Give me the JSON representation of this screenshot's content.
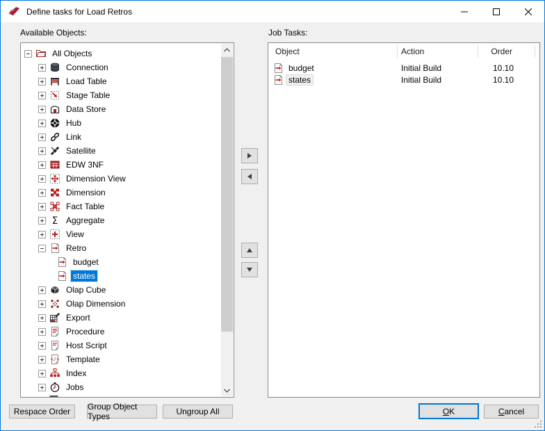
{
  "window": {
    "title": "Define tasks for Load Retros"
  },
  "title_controls": {
    "minimize": "minimize-icon",
    "maximize": "maximize-icon",
    "close": "close-icon"
  },
  "left_panel": {
    "label": "Available Objects:",
    "tree": [
      {
        "label": "All Objects",
        "icon": "folder",
        "level": 0,
        "expand": "minus",
        "selected": false
      },
      {
        "label": "Connection",
        "icon": "connection",
        "level": 1,
        "expand": "plus",
        "selected": false
      },
      {
        "label": "Load Table",
        "icon": "load-table",
        "level": 1,
        "expand": "plus",
        "selected": false
      },
      {
        "label": "Stage Table",
        "icon": "stage-table",
        "level": 1,
        "expand": "plus",
        "selected": false
      },
      {
        "label": "Data Store",
        "icon": "data-store",
        "level": 1,
        "expand": "plus",
        "selected": false
      },
      {
        "label": "Hub",
        "icon": "hub",
        "level": 1,
        "expand": "plus",
        "selected": false
      },
      {
        "label": "Link",
        "icon": "link",
        "level": 1,
        "expand": "plus",
        "selected": false
      },
      {
        "label": "Satellite",
        "icon": "satellite",
        "level": 1,
        "expand": "plus",
        "selected": false
      },
      {
        "label": "EDW 3NF",
        "icon": "edw-3nf",
        "level": 1,
        "expand": "plus",
        "selected": false
      },
      {
        "label": "Dimension View",
        "icon": "dimension-view",
        "level": 1,
        "expand": "plus",
        "selected": false
      },
      {
        "label": "Dimension",
        "icon": "dimension",
        "level": 1,
        "expand": "plus",
        "selected": false
      },
      {
        "label": "Fact Table",
        "icon": "fact-table",
        "level": 1,
        "expand": "plus",
        "selected": false
      },
      {
        "label": "Aggregate",
        "icon": "aggregate",
        "level": 1,
        "expand": "plus",
        "selected": false
      },
      {
        "label": "View",
        "icon": "view",
        "level": 1,
        "expand": "plus",
        "selected": false
      },
      {
        "label": "Retro",
        "icon": "retro",
        "level": 1,
        "expand": "minus",
        "selected": false
      },
      {
        "label": "budget",
        "icon": "retro",
        "level": 2,
        "expand": null,
        "selected": false
      },
      {
        "label": "states",
        "icon": "retro",
        "level": 2,
        "expand": null,
        "selected": true
      },
      {
        "label": "Olap Cube",
        "icon": "olap-cube",
        "level": 1,
        "expand": "plus",
        "selected": false
      },
      {
        "label": "Olap Dimension",
        "icon": "olap-dimension",
        "level": 1,
        "expand": "plus",
        "selected": false
      },
      {
        "label": "Export",
        "icon": "export",
        "level": 1,
        "expand": "plus",
        "selected": false
      },
      {
        "label": "Procedure",
        "icon": "procedure",
        "level": 1,
        "expand": "plus",
        "selected": false
      },
      {
        "label": "Host Script",
        "icon": "host-script",
        "level": 1,
        "expand": "plus",
        "selected": false
      },
      {
        "label": "Template",
        "icon": "template",
        "level": 1,
        "expand": "plus",
        "selected": false
      },
      {
        "label": "Index",
        "icon": "index",
        "level": 1,
        "expand": "plus",
        "selected": false
      },
      {
        "label": "Jobs",
        "icon": "jobs",
        "level": 1,
        "expand": "plus",
        "selected": false
      },
      {
        "label": "",
        "icon": "partial",
        "level": 1,
        "expand": "plus",
        "selected": false
      }
    ]
  },
  "transfer_buttons": [
    {
      "name": "move-right-button",
      "icon": "right-triangle-icon"
    },
    {
      "name": "move-left-button",
      "icon": "left-triangle-icon"
    },
    {
      "name": "move-up-button",
      "icon": "up-triangle-icon"
    },
    {
      "name": "move-down-button",
      "icon": "down-triangle-icon"
    }
  ],
  "right_panel": {
    "label": "Job Tasks:",
    "columns": [
      "Object",
      "Action",
      "Order"
    ],
    "rows": [
      {
        "object": "budget",
        "icon": "retro",
        "action": "Initial Build",
        "order": "10.10",
        "highlighted": false
      },
      {
        "object": "states",
        "icon": "retro",
        "action": "Initial Build",
        "order": "10.10",
        "highlighted": true
      }
    ]
  },
  "footer": {
    "respace": "Respace Order",
    "group": "Group Object Types",
    "ungroup": "Ungroup All",
    "ok_key": "O",
    "ok_rest": "K",
    "cancel_key": "C",
    "cancel_rest": "ancel"
  },
  "colors": {
    "accent": "#0078d7",
    "selection": "#0078d7",
    "icon_red": "#b01c1c",
    "icon_dark": "#1f1f1f",
    "button_face": "#e1e1e1",
    "panel_border": "#828790"
  }
}
